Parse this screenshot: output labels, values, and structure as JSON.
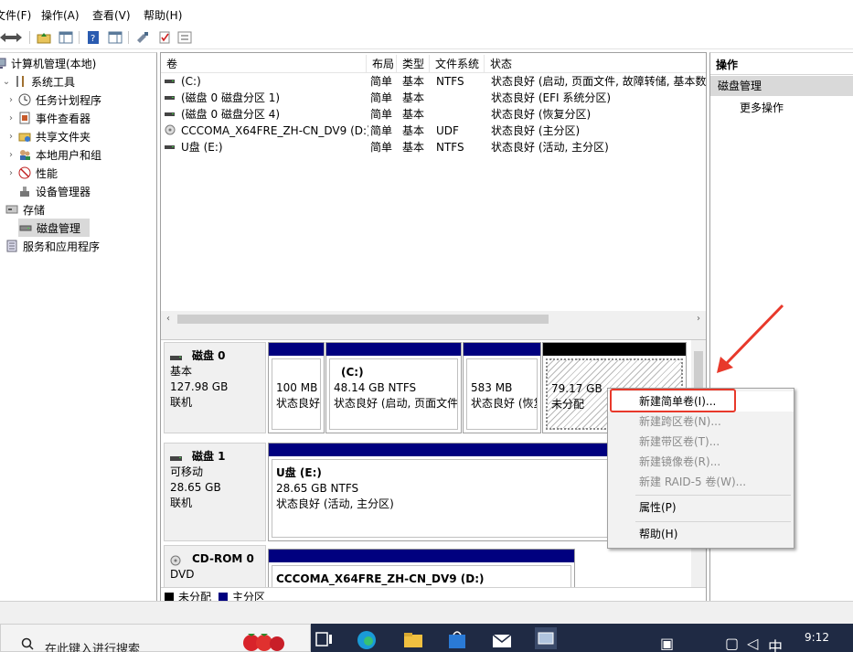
{
  "menu": [
    "文件(F)",
    "操作(A)",
    "查看(V)",
    "帮助(H)"
  ],
  "tree": {
    "root": "计算机管理(本地)",
    "system_tools": "系统工具",
    "task_scheduler": "任务计划程序",
    "event_viewer": "事件查看器",
    "shared_folders": "共享文件夹",
    "local_users": "本地用户和组",
    "performance": "性能",
    "device_manager": "设备管理器",
    "storage": "存储",
    "disk_management": "磁盘管理",
    "services_apps": "服务和应用程序"
  },
  "volume_list": {
    "headers": [
      "卷",
      "布局",
      "类型",
      "文件系统",
      "状态"
    ],
    "rows": [
      {
        "volume": "(C:)",
        "layout": "简单",
        "type": "基本",
        "fs": "NTFS",
        "status": "状态良好 (启动, 页面文件, 故障转储, 基本数"
      },
      {
        "volume": "(磁盘 0 磁盘分区 1)",
        "layout": "简单",
        "type": "基本",
        "fs": "",
        "status": "状态良好 (EFI 系统分区)"
      },
      {
        "volume": "(磁盘 0 磁盘分区 4)",
        "layout": "简单",
        "type": "基本",
        "fs": "",
        "status": "状态良好 (恢复分区)"
      },
      {
        "volume": "CCCOMA_X64FRE_ZH-CN_DV9 (D:)",
        "layout": "简单",
        "type": "基本",
        "fs": "UDF",
        "status": "状态良好 (主分区)"
      },
      {
        "volume": "U盘 (E:)",
        "layout": "简单",
        "type": "基本",
        "fs": "NTFS",
        "status": "状态良好 (活动, 主分区)"
      }
    ]
  },
  "disks": {
    "disk0": {
      "name": "磁盘 0",
      "type": "基本",
      "size": "127.98 GB",
      "state": "联机",
      "p1": {
        "size": "100 MB",
        "status": "状态良好"
      },
      "p2": {
        "title": "(C:)",
        "size": "48.14 GB NTFS",
        "status": "状态良好 (启动, 页面文件"
      },
      "p3": {
        "size": "583 MB",
        "status": "状态良好 (恢复"
      },
      "p4": {
        "size": "79.17 GB",
        "status": "未分配"
      }
    },
    "disk1": {
      "name": "磁盘 1",
      "type": "可移动",
      "size": "28.65 GB",
      "state": "联机",
      "p1": {
        "title": "U盘  (E:)",
        "size": "28.65 GB NTFS",
        "status": "状态良好 (活动, 主分区)"
      }
    },
    "cdrom0": {
      "name": "CD-ROM 0",
      "type": "DVD",
      "p1": {
        "title": "CCCOMA_X64FRE_ZH-CN_DV9  (D:)"
      }
    }
  },
  "legend": {
    "unallocated": "未分配",
    "primary": "主分区"
  },
  "actions": {
    "header": "操作",
    "selected": "磁盘管理",
    "more": "更多操作"
  },
  "context_menu": {
    "new_simple": "新建简单卷(I)...",
    "new_spanned": "新建跨区卷(N)...",
    "new_striped": "新建带区卷(T)...",
    "new_mirror": "新建镜像卷(R)...",
    "new_raid5": "新建 RAID-5 卷(W)...",
    "properties": "属性(P)",
    "help": "帮助(H)"
  },
  "taskbar": {
    "search_placeholder": "在此键入进行搜索",
    "time": "9:12",
    "ime": "中"
  },
  "colors": {
    "primary_partition": "#00007f",
    "unallocated": "#000000",
    "highlight": "#e8392b"
  }
}
